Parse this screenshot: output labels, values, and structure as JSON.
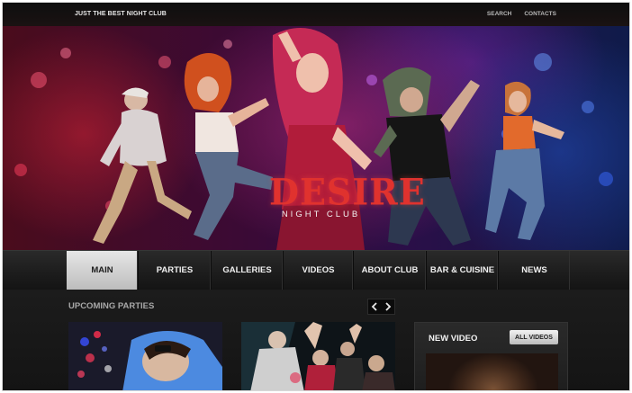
{
  "header": {
    "tagline": "JUST THE BEST NIGHT CLUB",
    "links": [
      {
        "label": "SEARCH"
      },
      {
        "label": "CONTACTS"
      }
    ]
  },
  "hero": {
    "brand_title": "DESIRE",
    "brand_subtitle": "NIGHT CLUB"
  },
  "nav": {
    "items": [
      {
        "label": "MAIN",
        "active": true
      },
      {
        "label": "PARTIES",
        "active": false
      },
      {
        "label": "GALLERIES",
        "active": false
      },
      {
        "label": "VIDEOS",
        "active": false
      },
      {
        "label": "ABOUT CLUB",
        "active": false
      },
      {
        "label": "BAR & CUISINE",
        "active": false
      },
      {
        "label": "NEWS",
        "active": false
      }
    ]
  },
  "upcoming": {
    "title": "UPCOMING PARTIES",
    "prev_icon": "chevron-left-icon",
    "next_icon": "chevron-right-icon"
  },
  "video": {
    "title": "NEW VIDEO",
    "all_label": "ALL VIDEOS"
  },
  "colors": {
    "brand_red": "#e0322e",
    "nav_active": "#d9d9d9",
    "background": "#161616"
  }
}
